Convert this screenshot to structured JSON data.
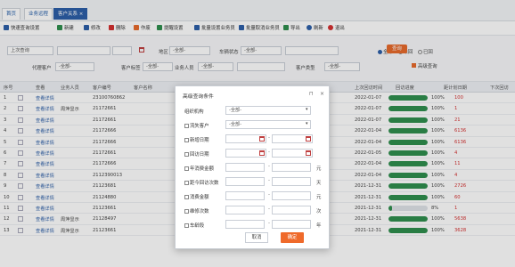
{
  "tabs": [
    {
      "label": "首页"
    },
    {
      "label": "业务远程"
    },
    {
      "label": "客户关系 ×"
    }
  ],
  "toolbar": [
    {
      "label": "快速查询设置",
      "color": "#2d5fa8"
    },
    {
      "label": "新建",
      "color": "#2f8f4e"
    },
    {
      "label": "修改",
      "color": "#2d5fa8"
    },
    {
      "label": "删除",
      "color": "#d43030"
    },
    {
      "label": "作废",
      "color": "#e86a2c"
    },
    {
      "label": "提醒设置",
      "color": "#2f8f4e"
    },
    {
      "label": "批量设置业务员",
      "color": "#2d5fa8"
    },
    {
      "label": "批量取消业务员",
      "color": "#2d5fa8"
    },
    {
      "label": "导出",
      "color": "#2f8f4e"
    },
    {
      "label": "刷新",
      "color": "#2d5fa8"
    },
    {
      "label": "退出",
      "color": "#d43030"
    }
  ],
  "filters": {
    "scope_value": "上次查询",
    "region_label": "地区",
    "region_value": "-全部-",
    "status_label": "车辆状态",
    "status_value": "-全部-",
    "agent_label": "代理客户",
    "agent_value": "-全部-",
    "tag_label": "客户标签",
    "tag_value": "-全部-",
    "salesman_label": "业务人员",
    "salesman_value": "-全部-",
    "type_label": "客户类型",
    "type_value": "-全部-",
    "radios": [
      "全部",
      "未回",
      "已回"
    ],
    "query_btn": "查询",
    "advanced": "高级查询"
  },
  "table": {
    "headers": [
      "序号",
      "查看",
      "业务人员",
      "客户编号",
      "客户名称",
      "上次回访时间",
      "回访进度",
      "距计划日期",
      "下次回访"
    ],
    "rows": [
      {
        "no": "1",
        "view": "查看详情",
        "sales": "",
        "code": "23100760862",
        "date": "2022-01-07",
        "pct": "100%",
        "fill": 1.0,
        "days": "100"
      },
      {
        "no": "2",
        "view": "查看详情",
        "sales": "周萍显示",
        "code": "21172661",
        "date": "2022-01-07",
        "pct": "100%",
        "fill": 1.0,
        "days": "1"
      },
      {
        "no": "3",
        "view": "查看详情",
        "sales": "",
        "code": "21172661",
        "date": "2022-01-07",
        "pct": "100%",
        "fill": 1.0,
        "days": "21"
      },
      {
        "no": "4",
        "view": "查看详情",
        "sales": "",
        "code": "21172666",
        "date": "2022-01-04",
        "pct": "100%",
        "fill": 1.0,
        "days": "6136"
      },
      {
        "no": "5",
        "view": "查看详情",
        "sales": "",
        "code": "21172666",
        "date": "2022-01-04",
        "pct": "100%",
        "fill": 1.0,
        "days": "6136"
      },
      {
        "no": "6",
        "view": "查看详情",
        "sales": "",
        "code": "21172661",
        "date": "2022-01-05",
        "pct": "100%",
        "fill": 1.0,
        "days": "4"
      },
      {
        "no": "7",
        "view": "查看详情",
        "sales": "",
        "code": "21172666",
        "date": "2022-01-04",
        "pct": "100%",
        "fill": 1.0,
        "days": "11"
      },
      {
        "no": "8",
        "view": "查看详情",
        "sales": "",
        "code": "2112390013",
        "date": "2022-01-04",
        "pct": "100%",
        "fill": 1.0,
        "days": "4"
      },
      {
        "no": "9",
        "view": "查看详情",
        "sales": "",
        "code": "21123681",
        "date": "2021-12-31",
        "pct": "100%",
        "fill": 1.0,
        "days": "2726"
      },
      {
        "no": "10",
        "view": "查看详情",
        "sales": "",
        "code": "21124880",
        "date": "2021-12-31",
        "pct": "100%",
        "fill": 1.0,
        "days": "60"
      },
      {
        "no": "11",
        "view": "查看详情",
        "sales": "",
        "code": "21123661",
        "date": "2021-12-31",
        "pct": "8%",
        "fill": 0.08,
        "days": "1"
      },
      {
        "no": "12",
        "view": "查看详情",
        "sales": "周萍显示",
        "code": "21128497",
        "date": "2021-12-31",
        "pct": "100%",
        "fill": 1.0,
        "days": "5638"
      },
      {
        "no": "13",
        "view": "查看详情",
        "sales": "周萍显示",
        "code": "21123661",
        "date": "2021-12-31",
        "pct": "100%",
        "fill": 1.0,
        "days": "3628"
      }
    ]
  },
  "dialog": {
    "title": "高级查询条件",
    "org_label": "组织机构",
    "org_value": "-全部-",
    "loss_label": "流失客户",
    "loss_value": "-全部-",
    "reg_label": "新增日期",
    "visit_label": "回访日期",
    "amount_label": "年消费金额",
    "count_label": "距今回访次数",
    "total_label": "消费金额",
    "times_label": "维修次数",
    "years_label": "车龄段",
    "unit_yuan": "元",
    "unit_day": "天",
    "unit_ci": "次",
    "unit_nian": "年",
    "cancel": "取消",
    "ok": "确定"
  }
}
